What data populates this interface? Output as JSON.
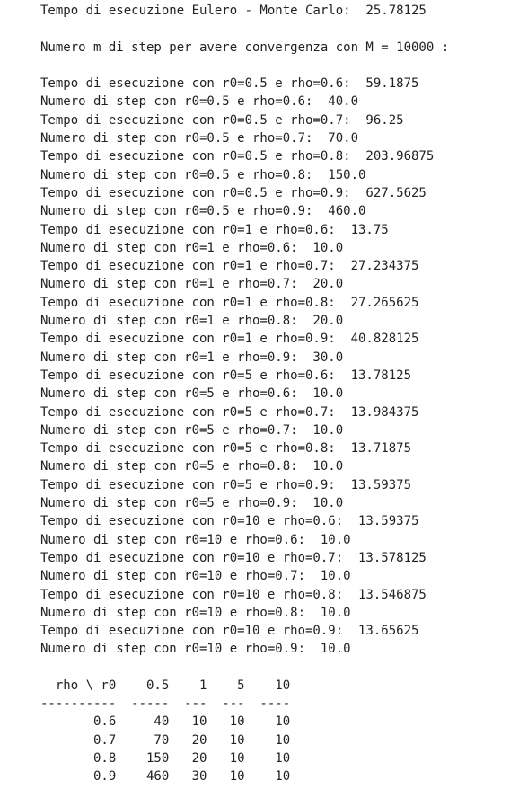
{
  "output": {
    "header": "Tempo di esecuzione Eulero - Monte Carlo:  25.78125",
    "m_line": "Numero m di step per avere convergenza con M = 10000 :",
    "results": [
      "Tempo di esecuzione con r0=0.5 e rho=0.6:  59.1875",
      "Numero di step con r0=0.5 e rho=0.6:  40.0",
      "Tempo di esecuzione con r0=0.5 e rho=0.7:  96.25",
      "Numero di step con r0=0.5 e rho=0.7:  70.0",
      "Tempo di esecuzione con r0=0.5 e rho=0.8:  203.96875",
      "Numero di step con r0=0.5 e rho=0.8:  150.0",
      "Tempo di esecuzione con r0=0.5 e rho=0.9:  627.5625",
      "Numero di step con r0=0.5 e rho=0.9:  460.0",
      "Tempo di esecuzione con r0=1 e rho=0.6:  13.75",
      "Numero di step con r0=1 e rho=0.6:  10.0",
      "Tempo di esecuzione con r0=1 e rho=0.7:  27.234375",
      "Numero di step con r0=1 e rho=0.7:  20.0",
      "Tempo di esecuzione con r0=1 e rho=0.8:  27.265625",
      "Numero di step con r0=1 e rho=0.8:  20.0",
      "Tempo di esecuzione con r0=1 e rho=0.9:  40.828125",
      "Numero di step con r0=1 e rho=0.9:  30.0",
      "Tempo di esecuzione con r0=5 e rho=0.6:  13.78125",
      "Numero di step con r0=5 e rho=0.6:  10.0",
      "Tempo di esecuzione con r0=5 e rho=0.7:  13.984375",
      "Numero di step con r0=5 e rho=0.7:  10.0",
      "Tempo di esecuzione con r0=5 e rho=0.8:  13.71875",
      "Numero di step con r0=5 e rho=0.8:  10.0",
      "Tempo di esecuzione con r0=5 e rho=0.9:  13.59375",
      "Numero di step con r0=5 e rho=0.9:  10.0",
      "Tempo di esecuzione con r0=10 e rho=0.6:  13.59375",
      "Numero di step con r0=10 e rho=0.6:  10.0",
      "Tempo di esecuzione con r0=10 e rho=0.7:  13.578125",
      "Numero di step con r0=10 e rho=0.7:  10.0",
      "Tempo di esecuzione con r0=10 e rho=0.8:  13.546875",
      "Numero di step con r0=10 e rho=0.8:  10.0",
      "Tempo di esecuzione con r0=10 e rho=0.9:  13.65625",
      "Numero di step con r0=10 e rho=0.9:  10.0"
    ],
    "table": [
      "  rho \\ r0    0.5    1    5    10",
      "----------  -----  ---  ---  ----",
      "       0.6     40   10   10    10",
      "       0.7     70   20   10    10",
      "       0.8    150   20   10    10",
      "       0.9    460   30   10    10"
    ]
  }
}
